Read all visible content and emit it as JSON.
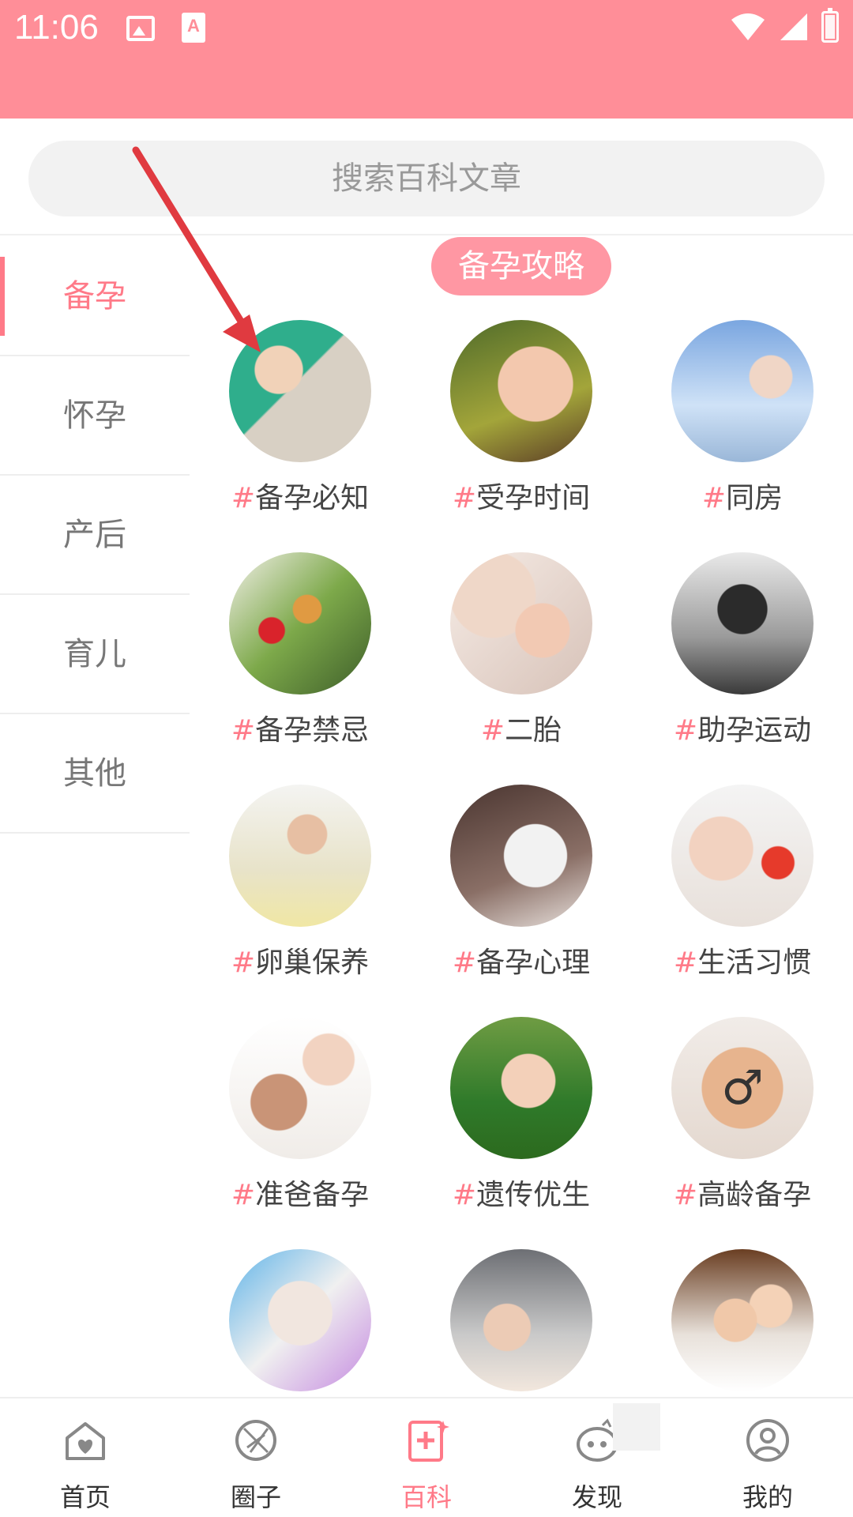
{
  "status_bar": {
    "time": "11:06"
  },
  "search": {
    "placeholder": "搜索百科文章"
  },
  "categories": [
    {
      "label": "备孕",
      "active": true
    },
    {
      "label": "怀孕",
      "active": false
    },
    {
      "label": "产后",
      "active": false
    },
    {
      "label": "育儿",
      "active": false
    },
    {
      "label": "其他",
      "active": false
    }
  ],
  "section": {
    "title": "备孕攻略"
  },
  "topics": [
    {
      "hash": "#",
      "label": "备孕必知"
    },
    {
      "hash": "#",
      "label": "受孕时间"
    },
    {
      "hash": "#",
      "label": "同房"
    },
    {
      "hash": "#",
      "label": "备孕禁忌"
    },
    {
      "hash": "#",
      "label": "二胎"
    },
    {
      "hash": "#",
      "label": "助孕运动"
    },
    {
      "hash": "#",
      "label": "卵巢保养"
    },
    {
      "hash": "#",
      "label": "备孕心理"
    },
    {
      "hash": "#",
      "label": "生活习惯"
    },
    {
      "hash": "#",
      "label": "准爸备孕"
    },
    {
      "hash": "#",
      "label": "遗传优生"
    },
    {
      "hash": "#",
      "label": "高龄备孕"
    },
    {
      "hash": "",
      "label": ""
    },
    {
      "hash": "",
      "label": ""
    },
    {
      "hash": "",
      "label": ""
    }
  ],
  "bottom_nav": [
    {
      "label": "首页",
      "icon": "home-heart-icon",
      "active": false
    },
    {
      "label": "圈子",
      "icon": "circle-icon",
      "active": false
    },
    {
      "label": "百科",
      "icon": "encyclopedia-icon",
      "active": true
    },
    {
      "label": "发现",
      "icon": "discover-icon",
      "active": false
    },
    {
      "label": "我的",
      "icon": "profile-icon",
      "active": false
    }
  ],
  "colors": {
    "accent": "#ff7a88",
    "header": "#ff8e98",
    "annotation": "#e03a40"
  }
}
